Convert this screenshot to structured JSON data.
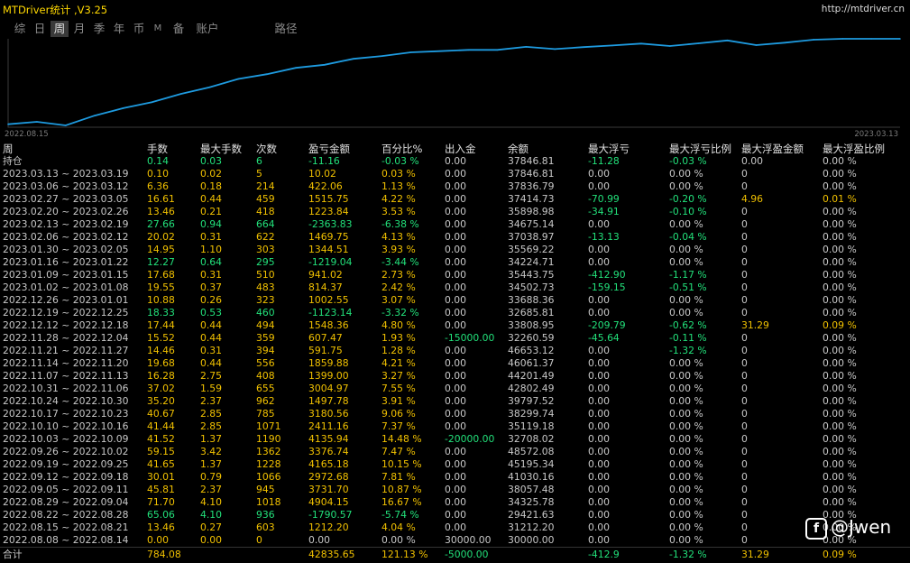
{
  "window": {
    "title": "MTDriver统计 ,V3.25",
    "site": "http://mtdriver.cn"
  },
  "tabs": [
    {
      "label": "综"
    },
    {
      "label": "日"
    },
    {
      "label": "周",
      "active": true
    },
    {
      "label": "月"
    },
    {
      "label": "季"
    },
    {
      "label": "年"
    },
    {
      "label": "币"
    },
    {
      "label": "M"
    },
    {
      "label": "备"
    },
    {
      "label": "账户"
    },
    {
      "label": "路径"
    }
  ],
  "chart_data": {
    "type": "line",
    "x_start_label": "2022.08.15",
    "x_end_label": "2023.03.13",
    "line_color": "#1e9be0",
    "x": [
      "2022.08.08 ~ 2022.08.14",
      "2022.08.15 ~ 2022.08.21",
      "2022.08.22 ~ 2022.08.28",
      "2022.08.29 ~ 2022.09.04",
      "2022.09.05 ~ 2022.09.11",
      "2022.09.12 ~ 2022.09.18",
      "2022.09.19 ~ 2022.09.25",
      "2022.09.26 ~ 2022.10.02",
      "2022.10.03 ~ 2022.10.09",
      "2022.10.10 ~ 2022.10.16",
      "2022.10.17 ~ 2022.10.23",
      "2022.10.24 ~ 2022.10.30",
      "2022.10.31 ~ 2022.11.06",
      "2022.11.07 ~ 2022.11.13",
      "2022.11.14 ~ 2022.11.20",
      "2022.11.21 ~ 2022.11.27",
      "2022.11.28 ~ 2022.12.04",
      "2022.12.05 ~ 2022.12.11",
      "2022.12.12 ~ 2022.12.18",
      "2022.12.19 ~ 2022.12.25",
      "2022.12.26 ~ 2023.01.01",
      "2023.01.02 ~ 2023.01.08",
      "2023.01.09 ~ 2023.01.15",
      "2023.01.16 ~ 2023.01.22",
      "2023.01.30 ~ 2023.02.05",
      "2023.02.06 ~ 2023.02.12",
      "2023.02.13 ~ 2023.02.19",
      "2023.02.20 ~ 2023.02.26",
      "2023.02.27 ~ 2023.03.05",
      "2023.03.06 ~ 2023.03.12",
      "2023.03.13 ~ 2023.03.19",
      "持仓"
    ],
    "y": [
      0,
      1212.2,
      -578.37,
      4326.08,
      8057.78,
      11030.46,
      15195.34,
      18572.08,
      22708.02,
      25119.2,
      28299.76,
      29797.32,
      32802.29,
      34201.49,
      36061.37,
      36653.12,
      37260.59,
      37260.59,
      38808.95,
      37685.81,
      38688.36,
      39502.73,
      40443.75,
      39224.71,
      40569.22,
      42038.97,
      39675.14,
      40898.98,
      42414.73,
      42836.79,
      42846.81,
      42835.65
    ]
  },
  "table": {
    "columns": [
      "周",
      "手数",
      "最大手数",
      "次数",
      "盈亏金额",
      "百分比%",
      "出入金",
      "余额",
      "最大浮亏",
      "最大浮亏比例",
      "最大浮盈金额",
      "最大浮盈比例"
    ],
    "rows": [
      [
        "持仓",
        "0.14",
        "0.03",
        "6",
        "-11.16",
        "-0.03 %",
        "0.00",
        "37846.81",
        "-11.28",
        "-0.03 %",
        "0.00",
        "0.00 %"
      ],
      [
        "2023.03.13 ~ 2023.03.19",
        "0.10",
        "0.02",
        "5",
        "10.02",
        "0.03 %",
        "0.00",
        "37846.81",
        "0.00",
        "0.00 %",
        "0",
        "0.00 %"
      ],
      [
        "2023.03.06 ~ 2023.03.12",
        "6.36",
        "0.18",
        "214",
        "422.06",
        "1.13 %",
        "0.00",
        "37836.79",
        "0.00",
        "0.00 %",
        "0",
        "0.00 %"
      ],
      [
        "2023.02.27 ~ 2023.03.05",
        "16.61",
        "0.44",
        "459",
        "1515.75",
        "4.22 %",
        "0.00",
        "37414.73",
        "-70.99",
        "-0.20 %",
        "4.96",
        "0.01 %"
      ],
      [
        "2023.02.20 ~ 2023.02.26",
        "13.46",
        "0.21",
        "418",
        "1223.84",
        "3.53 %",
        "0.00",
        "35898.98",
        "-34.91",
        "-0.10 %",
        "0",
        "0.00 %"
      ],
      [
        "2023.02.13 ~ 2023.02.19",
        "27.66",
        "0.94",
        "664",
        "-2363.83",
        "-6.38 %",
        "0.00",
        "34675.14",
        "0.00",
        "0.00 %",
        "0",
        "0.00 %"
      ],
      [
        "2023.02.06 ~ 2023.02.12",
        "20.02",
        "0.31",
        "622",
        "1469.75",
        "4.13 %",
        "0.00",
        "37038.97",
        "-13.13",
        "-0.04 %",
        "0",
        "0.00 %"
      ],
      [
        "2023.01.30 ~ 2023.02.05",
        "14.95",
        "1.10",
        "303",
        "1344.51",
        "3.93 %",
        "0.00",
        "35569.22",
        "0.00",
        "0.00 %",
        "0",
        "0.00 %"
      ],
      [
        "2023.01.16 ~ 2023.01.22",
        "12.27",
        "0.64",
        "295",
        "-1219.04",
        "-3.44 %",
        "0.00",
        "34224.71",
        "0.00",
        "0.00 %",
        "0",
        "0.00 %"
      ],
      [
        "2023.01.09 ~ 2023.01.15",
        "17.68",
        "0.31",
        "510",
        "941.02",
        "2.73 %",
        "0.00",
        "35443.75",
        "-412.90",
        "-1.17 %",
        "0",
        "0.00 %"
      ],
      [
        "2023.01.02 ~ 2023.01.08",
        "19.55",
        "0.37",
        "483",
        "814.37",
        "2.42 %",
        "0.00",
        "34502.73",
        "-159.15",
        "-0.51 %",
        "0",
        "0.00 %"
      ],
      [
        "2022.12.26 ~ 2023.01.01",
        "10.88",
        "0.26",
        "323",
        "1002.55",
        "3.07 %",
        "0.00",
        "33688.36",
        "0.00",
        "0.00 %",
        "0",
        "0.00 %"
      ],
      [
        "2022.12.19 ~ 2022.12.25",
        "18.33",
        "0.53",
        "460",
        "-1123.14",
        "-3.32 %",
        "0.00",
        "32685.81",
        "0.00",
        "0.00 %",
        "0",
        "0.00 %"
      ],
      [
        "2022.12.12 ~ 2022.12.18",
        "17.44",
        "0.44",
        "494",
        "1548.36",
        "4.80 %",
        "0.00",
        "33808.95",
        "-209.79",
        "-0.62 %",
        "31.29",
        "0.09 %"
      ],
      [
        "2022.11.28 ~ 2022.12.04",
        "15.52",
        "0.44",
        "359",
        "607.47",
        "1.93 %",
        "-15000.00",
        "32260.59",
        "-45.64",
        "-0.11 %",
        "0",
        "0.00 %"
      ],
      [
        "2022.11.21 ~ 2022.11.27",
        "14.46",
        "0.31",
        "394",
        "591.75",
        "1.28 %",
        "0.00",
        "46653.12",
        "0.00",
        "-1.32 %",
        "0",
        "0.00 %"
      ],
      [
        "2022.11.14 ~ 2022.11.20",
        "19.68",
        "0.44",
        "556",
        "1859.88",
        "4.21 %",
        "0.00",
        "46061.37",
        "0.00",
        "0.00 %",
        "0",
        "0.00 %"
      ],
      [
        "2022.11.07 ~ 2022.11.13",
        "16.28",
        "2.75",
        "408",
        "1399.00",
        "3.27 %",
        "0.00",
        "44201.49",
        "0.00",
        "0.00 %",
        "0",
        "0.00 %"
      ],
      [
        "2022.10.31 ~ 2022.11.06",
        "37.02",
        "1.59",
        "655",
        "3004.97",
        "7.55 %",
        "0.00",
        "42802.49",
        "0.00",
        "0.00 %",
        "0",
        "0.00 %"
      ],
      [
        "2022.10.24 ~ 2022.10.30",
        "35.20",
        "2.37",
        "962",
        "1497.78",
        "3.91 %",
        "0.00",
        "39797.52",
        "0.00",
        "0.00 %",
        "0",
        "0.00 %"
      ],
      [
        "2022.10.17 ~ 2022.10.23",
        "40.67",
        "2.85",
        "785",
        "3180.56",
        "9.06 %",
        "0.00",
        "38299.74",
        "0.00",
        "0.00 %",
        "0",
        "0.00 %"
      ],
      [
        "2022.10.10 ~ 2022.10.16",
        "41.44",
        "2.85",
        "1071",
        "2411.16",
        "7.37 %",
        "0.00",
        "35119.18",
        "0.00",
        "0.00 %",
        "0",
        "0.00 %"
      ],
      [
        "2022.10.03 ~ 2022.10.09",
        "41.52",
        "1.37",
        "1190",
        "4135.94",
        "14.48 %",
        "-20000.00",
        "32708.02",
        "0.00",
        "0.00 %",
        "0",
        "0.00 %"
      ],
      [
        "2022.09.26 ~ 2022.10.02",
        "59.15",
        "3.42",
        "1362",
        "3376.74",
        "7.47 %",
        "0.00",
        "48572.08",
        "0.00",
        "0.00 %",
        "0",
        "0.00 %"
      ],
      [
        "2022.09.19 ~ 2022.09.25",
        "41.65",
        "1.37",
        "1228",
        "4165.18",
        "10.15 %",
        "0.00",
        "45195.34",
        "0.00",
        "0.00 %",
        "0",
        "0.00 %"
      ],
      [
        "2022.09.12 ~ 2022.09.18",
        "30.01",
        "0.79",
        "1066",
        "2972.68",
        "7.81 %",
        "0.00",
        "41030.16",
        "0.00",
        "0.00 %",
        "0",
        "0.00 %"
      ],
      [
        "2022.09.05 ~ 2022.09.11",
        "45.81",
        "2.37",
        "945",
        "3731.70",
        "10.87 %",
        "0.00",
        "38057.48",
        "0.00",
        "0.00 %",
        "0",
        "0.00 %"
      ],
      [
        "2022.08.29 ~ 2022.09.04",
        "71.70",
        "4.10",
        "1018",
        "4904.15",
        "16.67 %",
        "0.00",
        "34325.78",
        "0.00",
        "0.00 %",
        "0",
        "0.00 %"
      ],
      [
        "2022.08.22 ~ 2022.08.28",
        "65.06",
        "4.10",
        "936",
        "-1790.57",
        "-5.74 %",
        "0.00",
        "29421.63",
        "0.00",
        "0.00 %",
        "0",
        "0.00 %"
      ],
      [
        "2022.08.15 ~ 2022.08.21",
        "13.46",
        "0.27",
        "603",
        "1212.20",
        "4.04 %",
        "0.00",
        "31212.20",
        "0.00",
        "0.00 %",
        "0",
        "0.00 %"
      ],
      [
        "2022.08.08 ~ 2022.08.14",
        "0.00",
        "0.00",
        "0",
        "0.00",
        "0.00 %",
        "30000.00",
        "30000.00",
        "0.00",
        "0.00 %",
        "0",
        "0.00 %"
      ]
    ],
    "total": [
      "合计",
      "784.08",
      "",
      "",
      "42835.65",
      "121.13 %",
      "-5000.00",
      "",
      "-412.9",
      "-1.32 %",
      "31.29",
      "0.09 %"
    ]
  },
  "colors": {
    "positive": "#f0c000",
    "negative": "#22e07a",
    "neutral": "#c8c8c8",
    "title": "#ffd800",
    "chart_line": "#1e9be0"
  },
  "watermark": {
    "icon": "facebook-icon",
    "text": "@Jwen"
  }
}
